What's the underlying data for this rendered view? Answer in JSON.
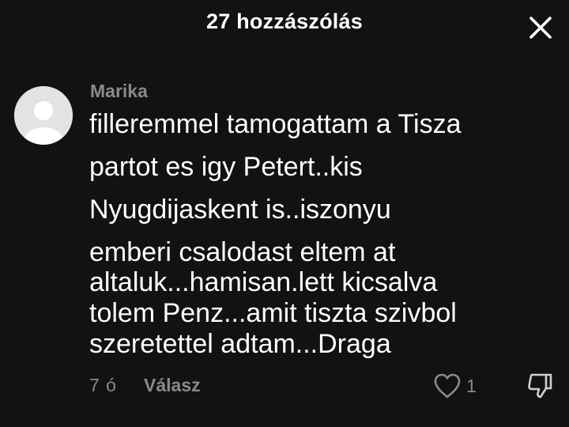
{
  "header": {
    "title": "27 hozzászólás",
    "close_icon": "close-icon"
  },
  "comment": {
    "username": "Marika",
    "avatar_icon": "default-avatar-icon",
    "text_lines": [
      "filleremmel tamogattam a Tisza",
      "partot es igy Petert..kis",
      "Nyugdijaskent is..iszonyu",
      "emberi csalodast eltem at",
      "altaluk...hamisan.lett kicsalva",
      "tolem Penz...amit tiszta szivbol",
      "szeretettel adtam...Draga"
    ],
    "time": "7 ó",
    "reply_label": "Válasz",
    "like_count": "1",
    "like_icon": "heart-outline-icon",
    "dislike_icon": "thumbs-down-icon"
  },
  "colors": {
    "background": "#121212",
    "primary_text": "#ffffff",
    "secondary_text": "#8a8a8a",
    "avatar_bg": "#e3e3e3"
  }
}
